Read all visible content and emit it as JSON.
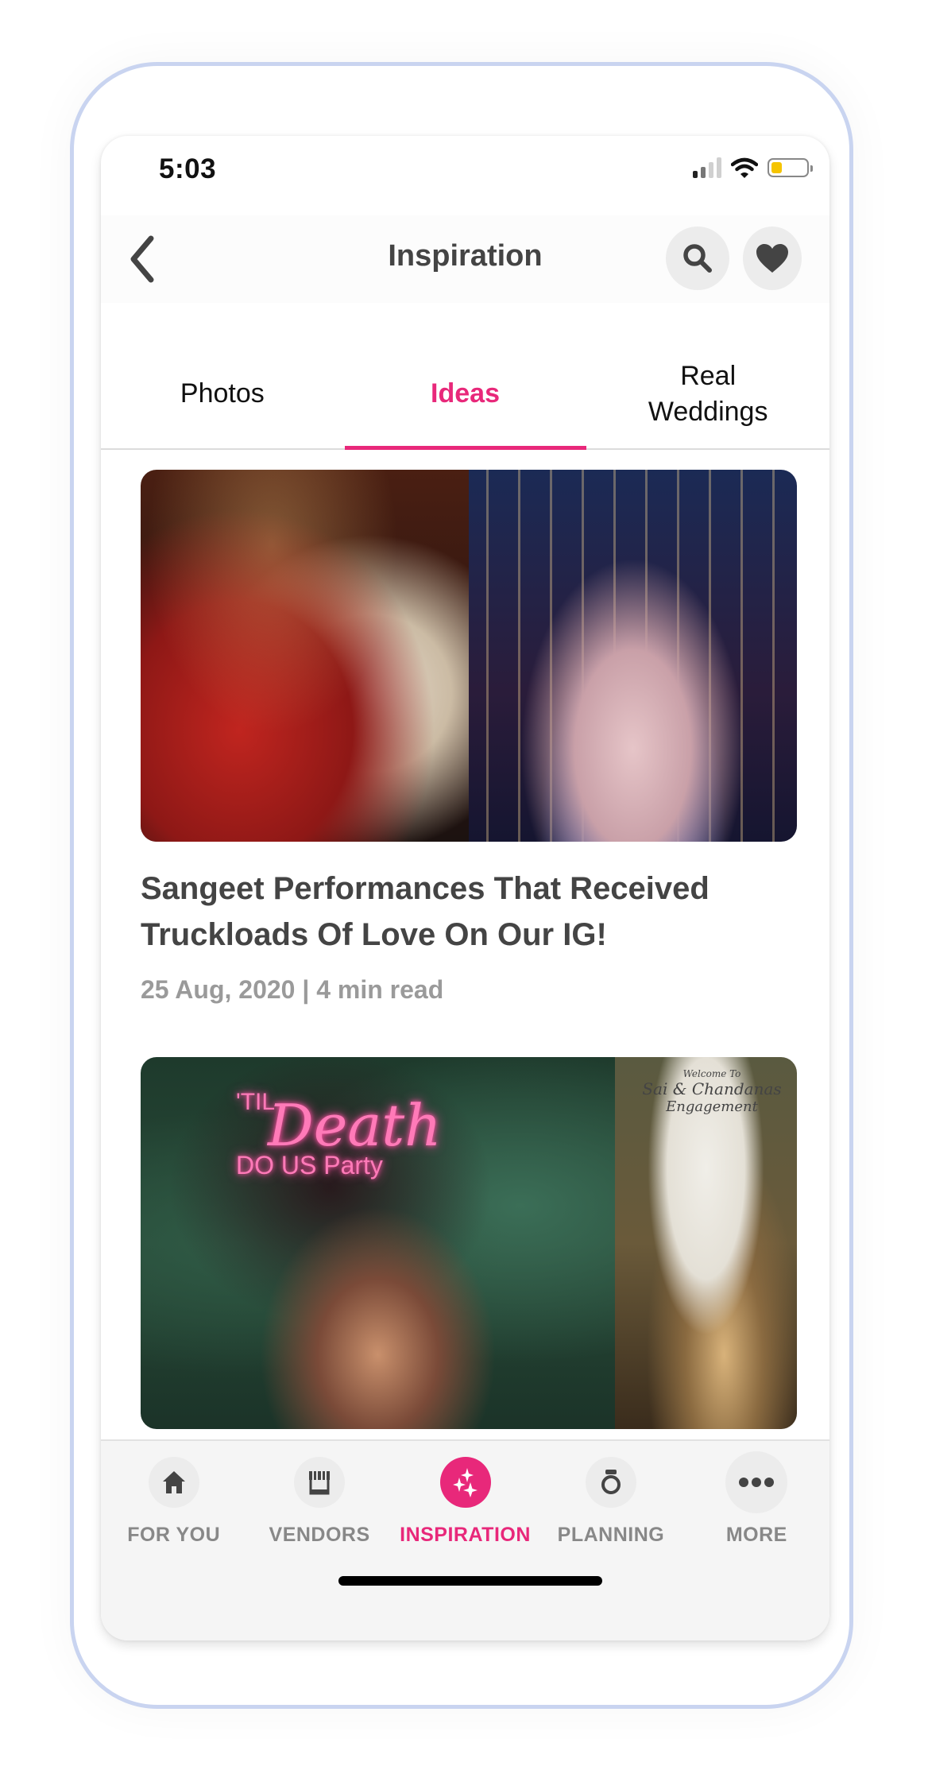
{
  "status_bar": {
    "time": "5:03",
    "signal_bars": 2,
    "battery_level": 0.25,
    "battery_color": "#f5c400"
  },
  "header": {
    "title": "Inspiration",
    "back_icon": "chevron-left-icon",
    "search_icon": "search-icon",
    "favorite_icon": "heart-icon"
  },
  "tabs": [
    {
      "label": "Photos",
      "active": false
    },
    {
      "label": "Ideas",
      "active": true
    },
    {
      "label": "Real Weddings",
      "active": false
    }
  ],
  "accent_color": "#e8287a",
  "articles": [
    {
      "title": "Sangeet Performances That Received Truckloads Of Love On Our IG!",
      "meta": "25 Aug, 2020 | 4 min read",
      "image_description": "Couple dancing in bridal wear; bride twirling in lehenga under string lights"
    },
    {
      "image_description": "Couple embracing under neon sign; engagement welcome board with candles",
      "neon_sign": {
        "line1": "'TIL",
        "line2": "Death",
        "line3": "DO US Party"
      },
      "welcome_board": {
        "line1": "Welcome To",
        "line2": "Sai & Chandanas",
        "line3": "Engagement"
      }
    }
  ],
  "bottom_nav": [
    {
      "label": "FOR YOU",
      "icon": "home-icon",
      "active": false
    },
    {
      "label": "VENDORS",
      "icon": "store-icon",
      "active": false
    },
    {
      "label": "INSPIRATION",
      "icon": "sparkles-icon",
      "active": true
    },
    {
      "label": "PLANNING",
      "icon": "ring-icon",
      "active": false
    },
    {
      "label": "MORE",
      "icon": "more-icon",
      "active": false
    }
  ]
}
